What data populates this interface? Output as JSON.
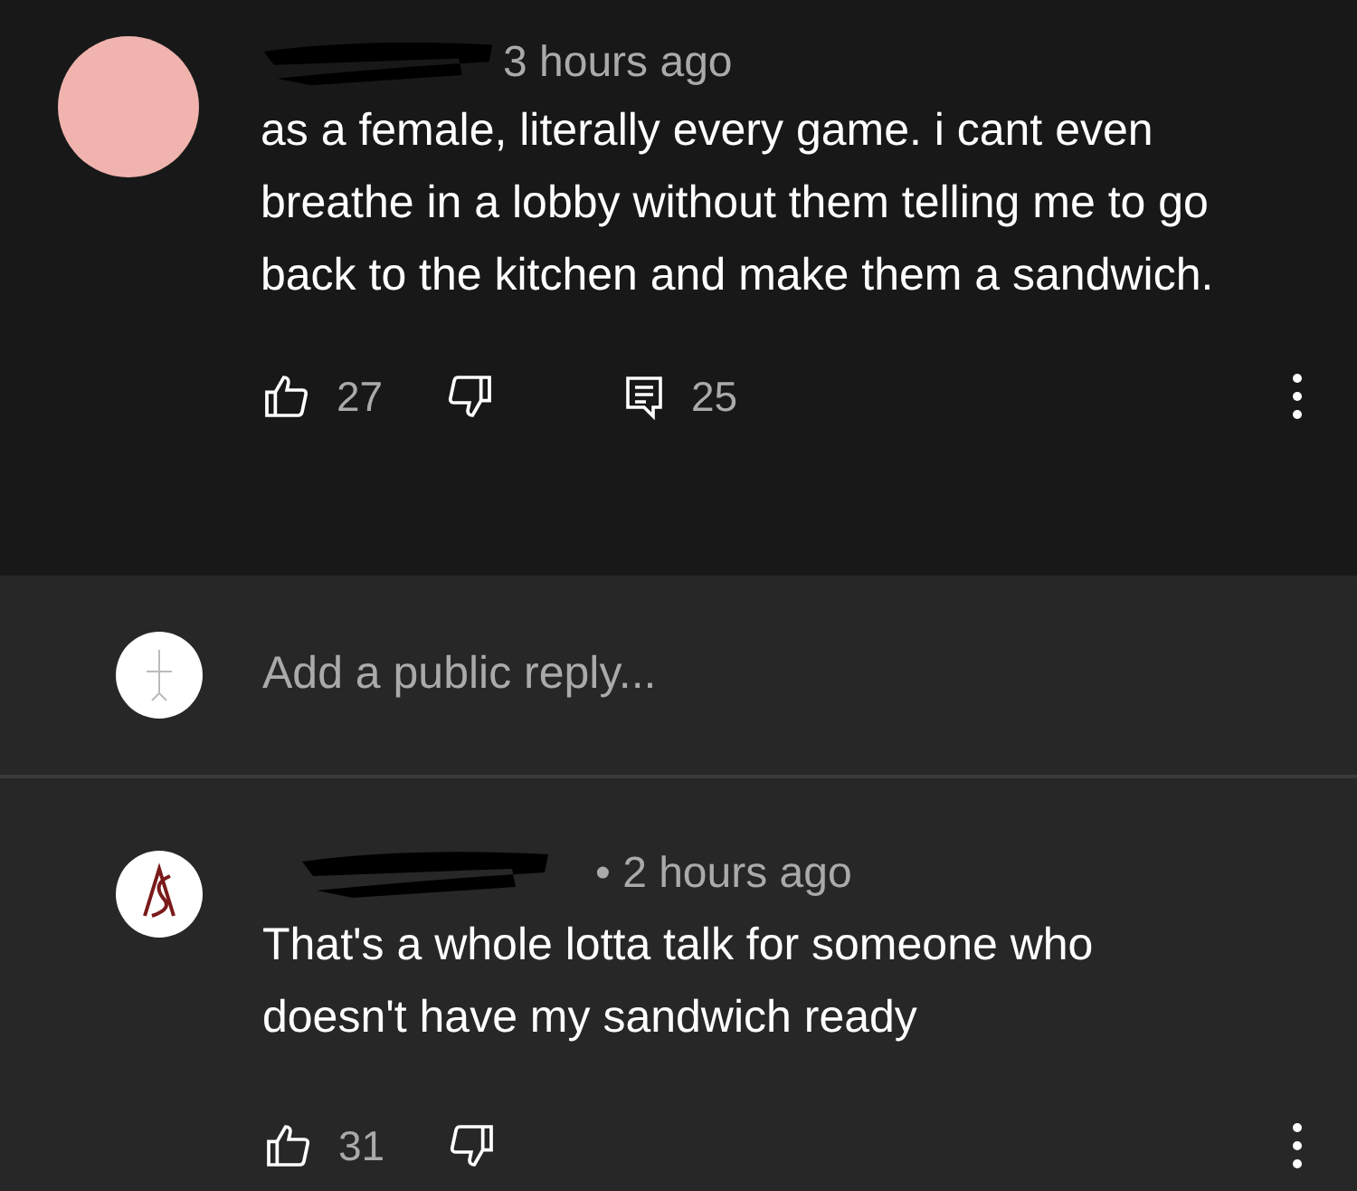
{
  "comment": {
    "time": "3 hours ago",
    "text": "as a female, literally every game. i cant even breathe in a lobby without them telling me to go back to the kitchen and make them a sandwich.",
    "likes": "27",
    "replies": "25"
  },
  "reply_box": {
    "placeholder": "Add a public reply..."
  },
  "replies": [
    {
      "time": "• 2 hours ago",
      "text": "That's a whole lotta talk for someone who doesn't have my sandwich ready",
      "likes": "31"
    }
  ]
}
